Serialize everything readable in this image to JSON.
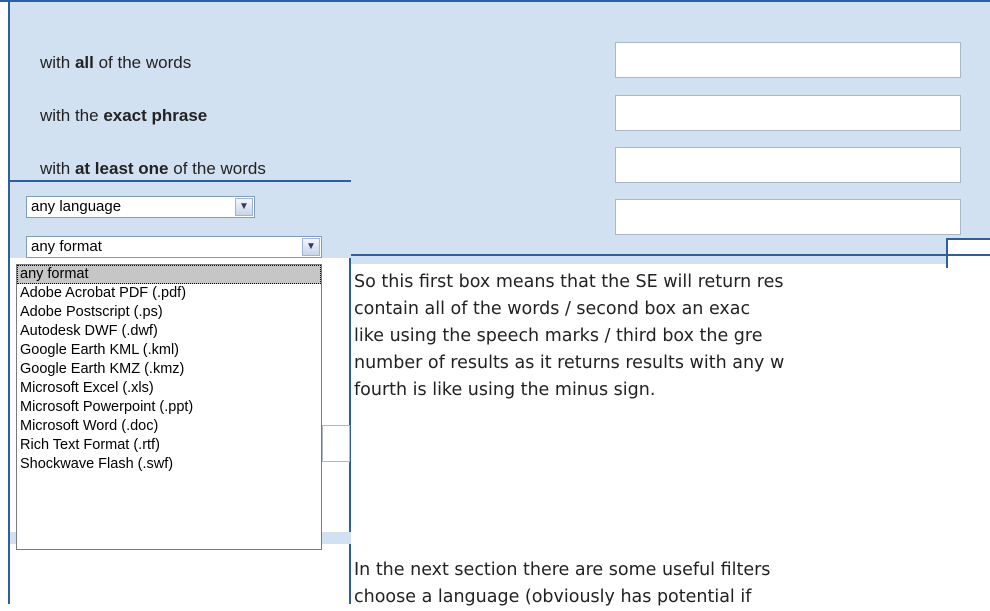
{
  "search_panel": {
    "rows": [
      {
        "prefix": "with ",
        "bold": "all",
        "suffix": " of the words"
      },
      {
        "prefix": "with the ",
        "bold": "exact phrase",
        "suffix": ""
      },
      {
        "prefix": "with ",
        "bold": "at least one",
        "suffix": " of the words"
      }
    ]
  },
  "language_select": {
    "value": "any language"
  },
  "format_select": {
    "value": "any format",
    "options": [
      "any format",
      "Adobe Acrobat PDF (.pdf)",
      "Adobe Postscript (.ps)",
      "Autodesk DWF (.dwf)",
      "Google Earth KML (.kml)",
      "Google Earth KMZ (.kmz)",
      "Microsoft Excel (.xls)",
      "Microsoft Powerpoint (.ppt)",
      "Microsoft Word (.doc)",
      "Rich Text Format (.rtf)",
      "Shockwave Flash (.swf)"
    ],
    "selected_index": 0
  },
  "body_text": {
    "paragraph1": [
      "So this first box means that the SE will return res",
      "contain all of  the words / second box an exac",
      "like using the speech marks  / third box the gre",
      "number of results as it returns results with any w",
      "fourth is like using the minus sign."
    ],
    "paragraph2": [
      "In the next section there are some useful filters",
      "choose a language (obviously has potential if"
    ]
  }
}
